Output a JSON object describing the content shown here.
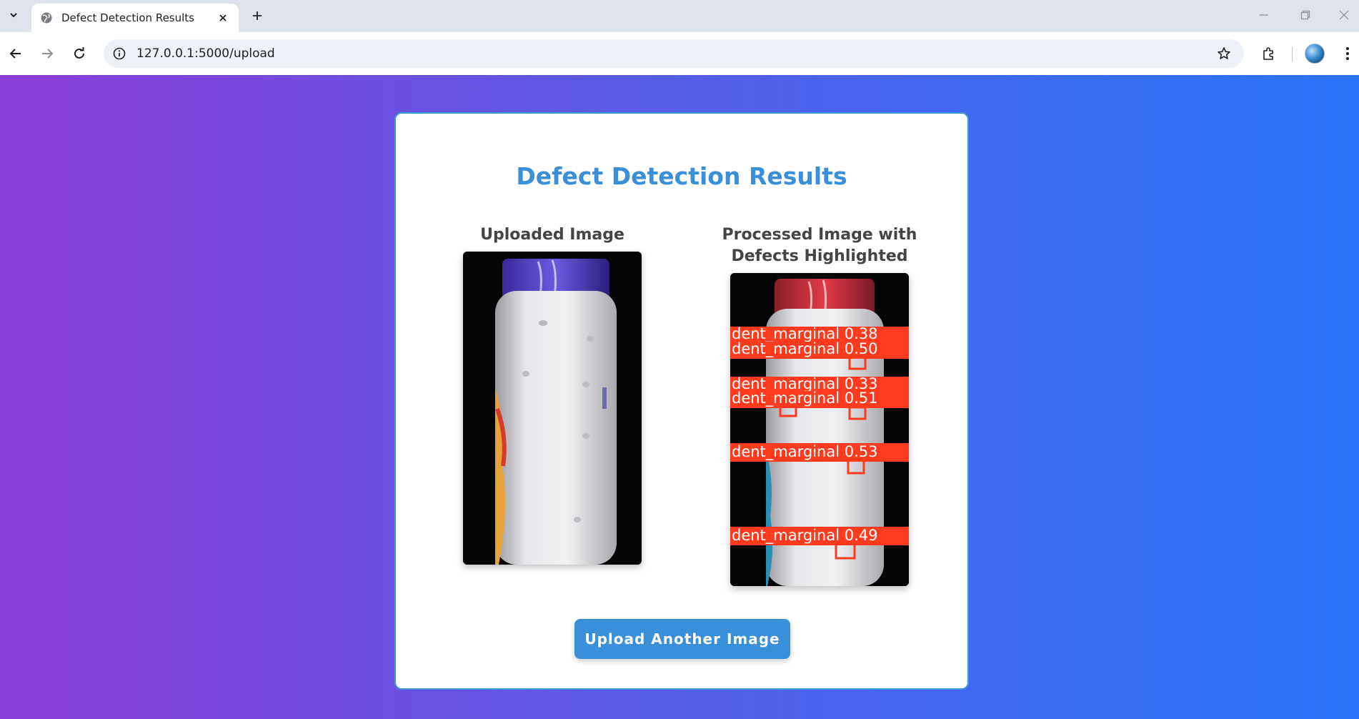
{
  "browser": {
    "tab_title": "Defect Detection Results",
    "url": "127.0.0.1:5000/upload"
  },
  "page": {
    "title": "Defect Detection Results",
    "uploaded_label": "Uploaded Image",
    "processed_label": "Processed Image with Defects Highlighted",
    "upload_button": "Upload Another Image"
  },
  "detections": [
    {
      "label": "dent_marginal 0.38"
    },
    {
      "label": "dent_marginal 0.50"
    },
    {
      "label": "dent_marginal 0.33"
    },
    {
      "label": "dent_marginal 0.51"
    },
    {
      "label": "dent_marginal 0.53"
    },
    {
      "label": "dent_marginal 0.49"
    }
  ],
  "colors": {
    "title": "#3a8fd8",
    "button": "#3a90d8",
    "card_border": "#3a94d6",
    "gradient_start": "#8a3cd6",
    "gradient_end": "#2a74fb",
    "detection_box": "#ff3b1f"
  },
  "icons": {
    "tab_search": "chevron-down-icon",
    "favicon": "globe-icon",
    "tab_close": "close-icon",
    "new_tab": "plus-icon",
    "back": "arrow-left-icon",
    "forward": "arrow-right-icon",
    "reload": "reload-icon",
    "site_info": "info-icon",
    "bookmark": "star-icon",
    "extensions": "puzzle-icon",
    "menu": "kebab-menu-icon"
  }
}
